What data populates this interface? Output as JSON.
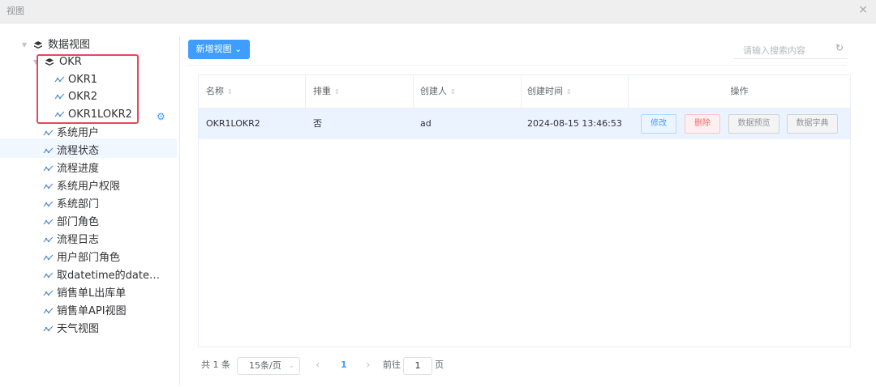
{
  "window": {
    "title": "视图",
    "close_glyph": "×"
  },
  "tree": {
    "root": {
      "label": "数据视图",
      "icon": "layers-icon"
    },
    "group": {
      "label": "OKR",
      "icon": "layers-icon"
    },
    "group_children": [
      "OKR1",
      "OKR2",
      "OKR1LOKR2"
    ],
    "views": [
      "系统用户",
      "流程状态",
      "流程进度",
      "系统用户权限",
      "系统部门",
      "部门角色",
      "流程日志",
      "用户部门角色",
      "取datetime的date…",
      "销售单L出库单",
      "销售单API视图",
      "天气视图"
    ]
  },
  "toolbar": {
    "new_label": "新增视图",
    "new_chevron": "⌄"
  },
  "search": {
    "placeholder": "请输入搜索内容",
    "value": ""
  },
  "table": {
    "headers": {
      "name": "名称",
      "sort": "排重",
      "creator": "创建人",
      "created": "创建时间",
      "actions": "操作"
    },
    "sort_glyph": "⇕",
    "rows": [
      {
        "name": "OKR1LOKR2",
        "sort": "否",
        "creator": "ad",
        "created": "2024-08-15 13:46:53"
      }
    ],
    "actions": {
      "edit": "修改",
      "delete": "删除",
      "preview": "数据预览",
      "dict": "数据字典"
    }
  },
  "pagination": {
    "total": "共 1 条",
    "page_size": "15条/页",
    "prev": "‹",
    "current": "1",
    "next": "›",
    "goto_prefix": "前往",
    "goto_value": "1",
    "goto_suffix": "页"
  },
  "colors": {
    "accent": "#409eff",
    "highlight_border": "#e8465c",
    "selected_row": "#eaf3ff"
  }
}
